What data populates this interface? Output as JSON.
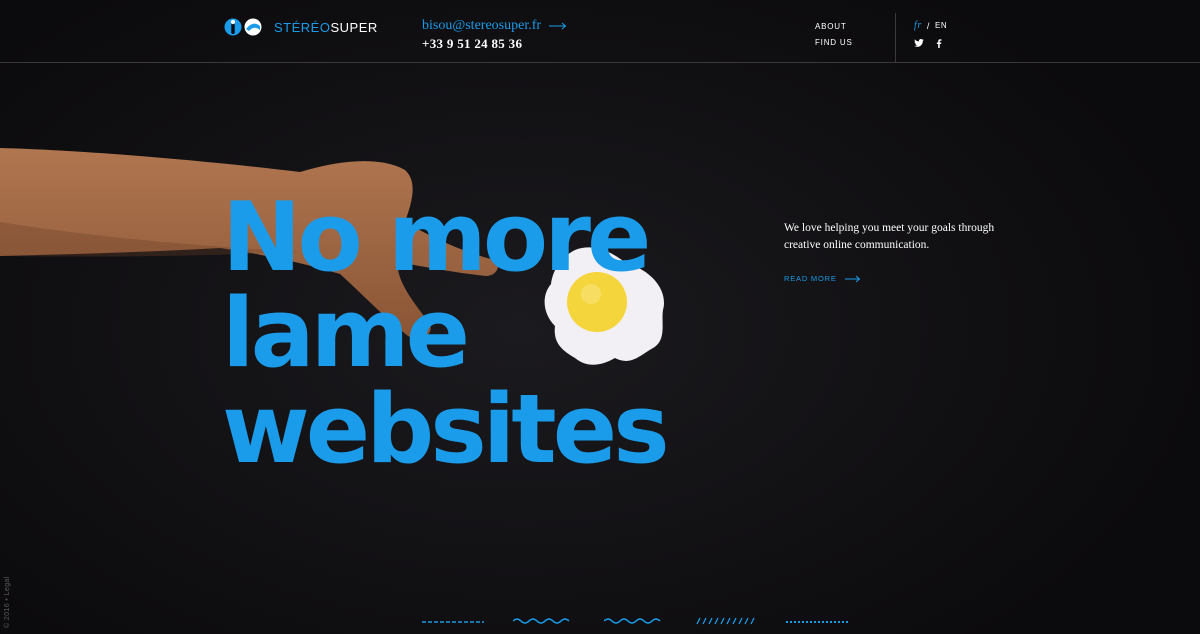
{
  "header": {
    "logo_prefix": "STÉRÉO",
    "logo_suffix": "SUPER",
    "email": "bisou@stereosuper.fr",
    "phone": "+33 9 51 24 85 36",
    "nav": [
      {
        "label": "ABOUT"
      },
      {
        "label": "FIND US"
      }
    ],
    "lang_active": "fr",
    "lang_separator": "/",
    "lang_other": "EN"
  },
  "hero": {
    "headline_line1": "No more",
    "headline_line2": "lame",
    "headline_line3": "websites",
    "tagline": "We love helping you meet your goals through creative online communication.",
    "read_more": "READ MORE"
  },
  "footer": {
    "legal": "© 2016 • Legal"
  },
  "colors": {
    "accent": "#1a9cea",
    "background": "#0d0c0e",
    "divider": "#3a393c"
  }
}
